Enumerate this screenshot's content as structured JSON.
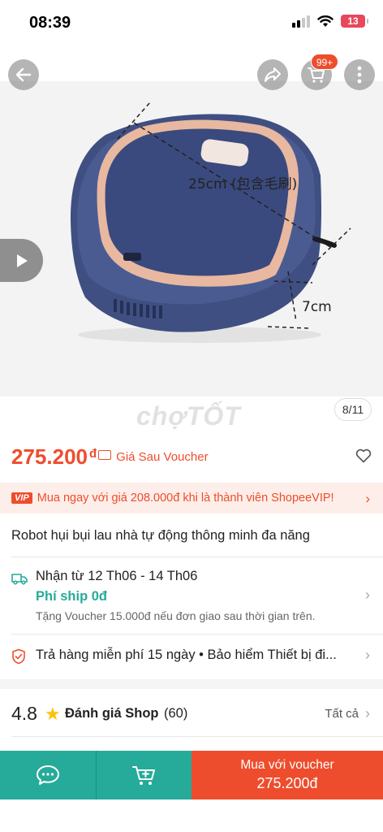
{
  "status_bar": {
    "time": "08:39",
    "battery": "13"
  },
  "gallery": {
    "cart_badge": "99+",
    "dimension_width": "25cm (包含毛刷)",
    "dimension_height": "7cm",
    "watermark": "chợTỐT",
    "page_counter": "8/11"
  },
  "price": {
    "amount": "275.200",
    "currency": "đ",
    "voucher_label": "Giá Sau Voucher"
  },
  "vip": {
    "badge": "VIP",
    "text": "Mua ngay với giá 208.000đ khi là thành viên ShopeeVIP!"
  },
  "product": {
    "title": "Robot hụi bụi lau nhà tự động thông minh đa năng"
  },
  "shipping": {
    "date": "Nhận từ 12 Th06 - 14 Th06",
    "fee": "Phí ship 0đ",
    "note": "Tặng Voucher 15.000đ nếu đơn giao sau thời gian trên."
  },
  "returns": {
    "text": "Trả hàng miễn phí 15 ngày  •  Bảo hiểm Thiết bị đi..."
  },
  "rating": {
    "score": "4.8",
    "label": "Đánh giá Shop",
    "count": "(60)",
    "see_all": "Tất cả"
  },
  "bottom_bar": {
    "buy_line1": "Mua với voucher",
    "buy_line2": "275.200đ"
  },
  "colors": {
    "brand": "#ee4d2d",
    "teal": "#26aa99",
    "robot_body": "#3f4f82"
  }
}
